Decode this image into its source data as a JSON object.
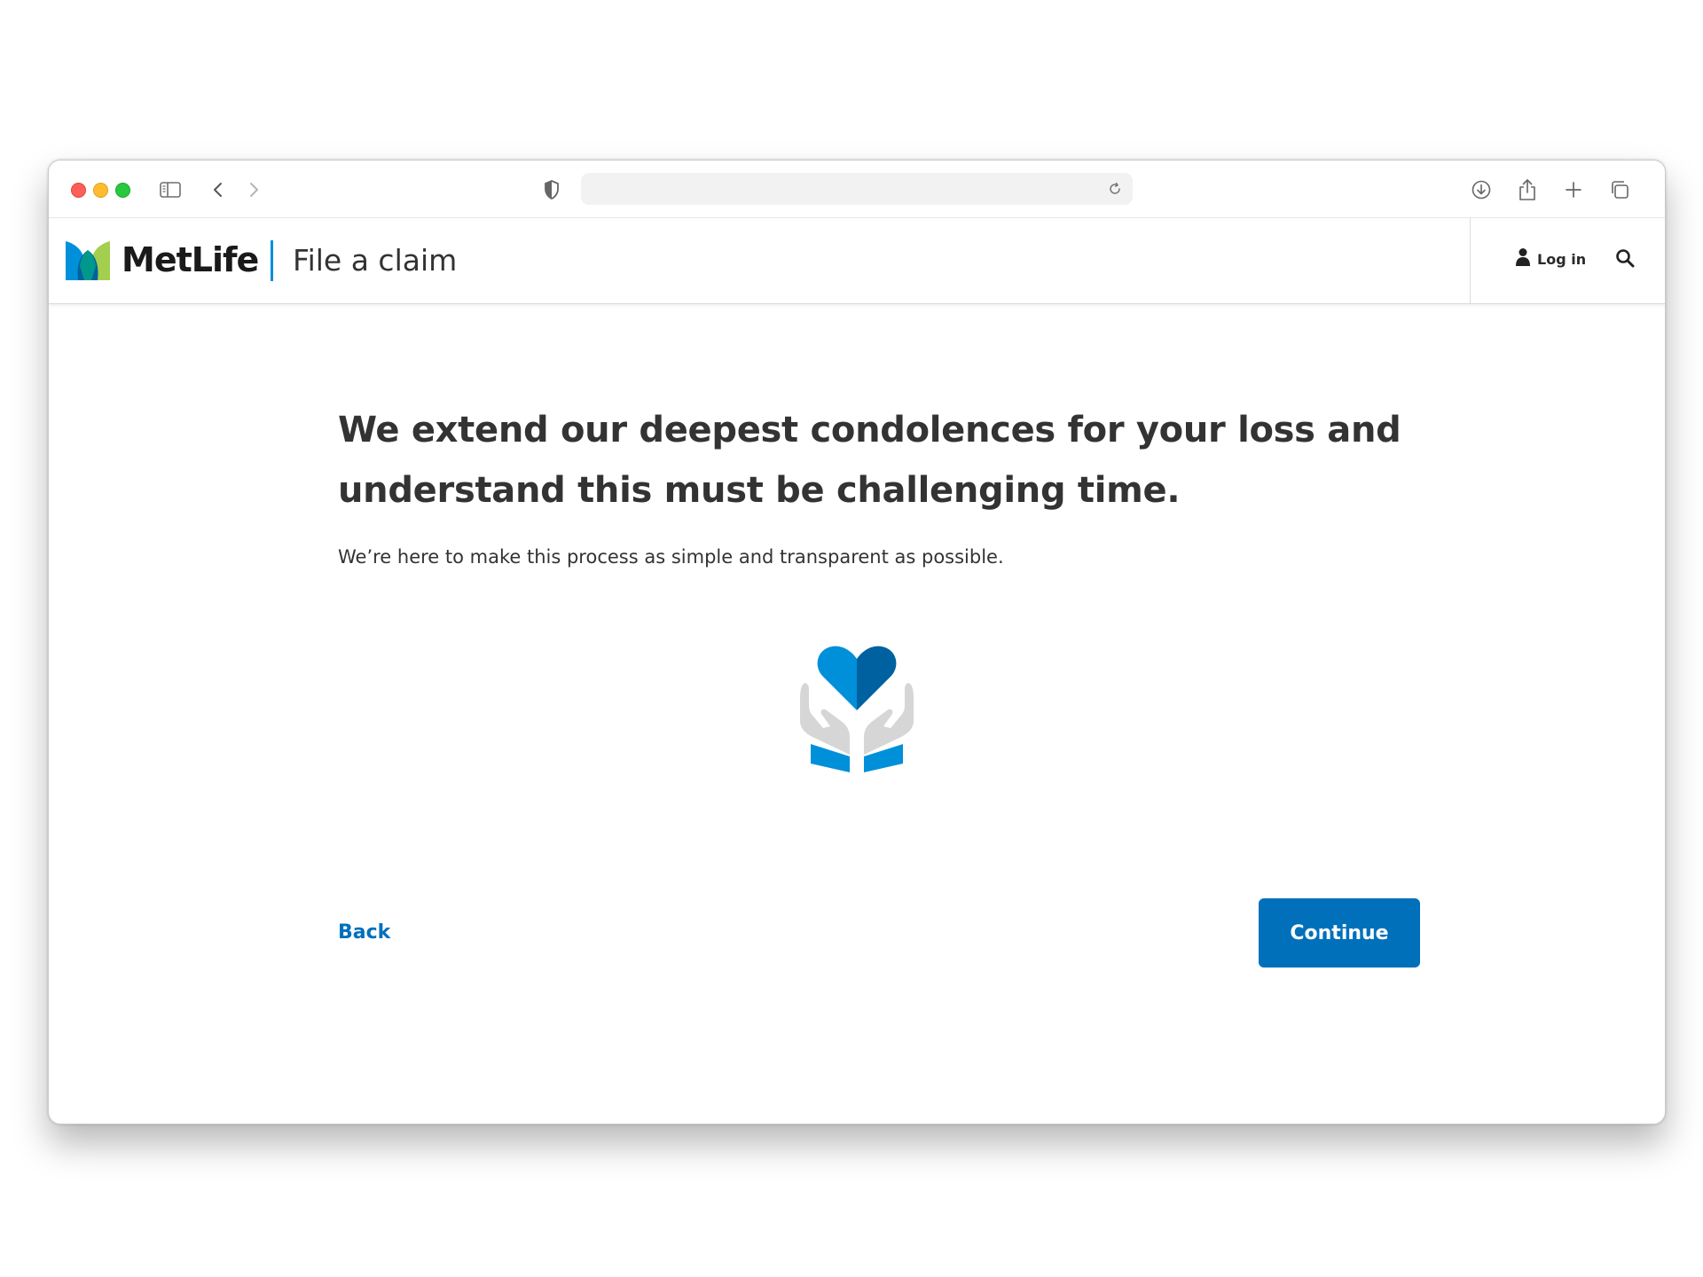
{
  "site": {
    "brand": "MetLife",
    "section_title": "File a claim",
    "login_label": "Log in"
  },
  "icons": {
    "sidebar": "sidebar-icon",
    "back": "chevron-left-icon",
    "forward": "chevron-right-icon",
    "privacy": "shield-icon",
    "reload": "reload-icon",
    "download": "download-icon",
    "share": "share-icon",
    "new_tab": "plus-icon",
    "tabs": "tabs-overview-icon",
    "user": "user-icon",
    "search": "search-icon",
    "illustration": "heart-in-hands-icon"
  },
  "content": {
    "heading": "We extend our deepest condolences for your loss and understand this must be challenging time.",
    "subtext": "We’re here to make this process as simple and transparent as possible."
  },
  "actions": {
    "back_label": "Back",
    "continue_label": "Continue"
  },
  "colors": {
    "primary": "#0070bb",
    "accent_blue": "#0090da",
    "brand_green": "#a4ce4e",
    "text": "#333333"
  }
}
